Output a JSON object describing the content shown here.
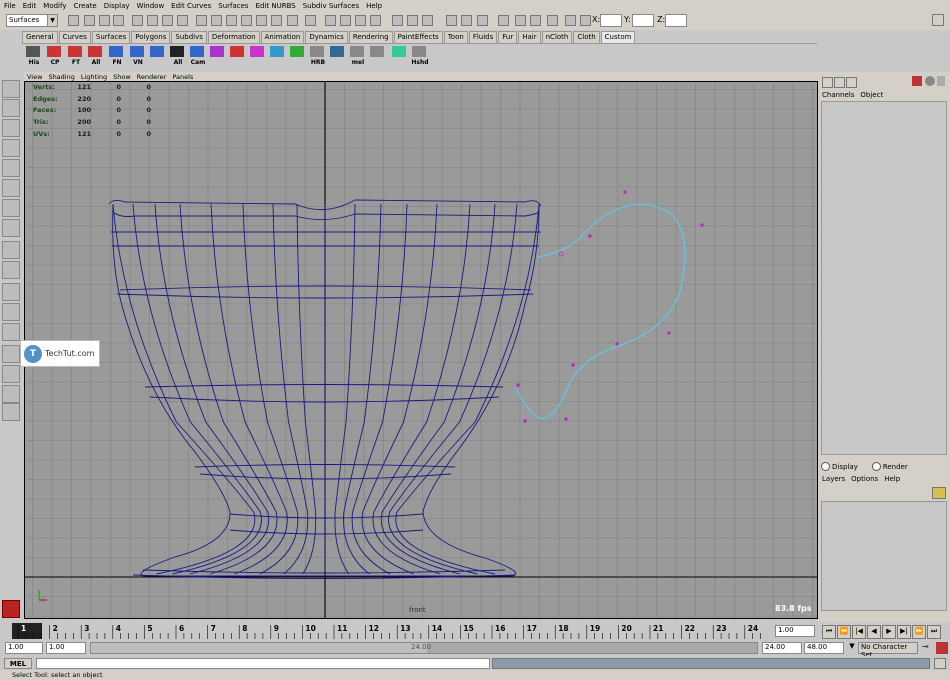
{
  "menu": [
    "File",
    "Edit",
    "Modify",
    "Create",
    "Display",
    "Window",
    "Edit Curves",
    "Surfaces",
    "Edit NURBS",
    "Subdiv Surfaces",
    "Help"
  ],
  "status_line": {
    "mode": "Surfaces",
    "x_label": "X:",
    "y_label": "Y:",
    "z_label": "Z:"
  },
  "shelf_tabs": [
    "General",
    "Curves",
    "Surfaces",
    "Polygons",
    "Subdivs",
    "Deformation",
    "Animation",
    "Dynamics",
    "Rendering",
    "PaintEffects",
    "Toon",
    "Fluids",
    "Fur",
    "Hair",
    "nCloth",
    "Cloth",
    "Custom"
  ],
  "active_shelf_tab": "Custom",
  "shelf_buttons": [
    "His",
    "CP",
    "FT",
    "All",
    "FN",
    "VN",
    "",
    "All",
    "Cam",
    "",
    "",
    "",
    "",
    "",
    "HRB",
    "",
    "mel",
    "",
    "",
    "Hshd"
  ],
  "panel_menu": [
    "View",
    "Shading",
    "Lighting",
    "Show",
    "Renderer",
    "Panels"
  ],
  "hud": [
    {
      "label": "Verts:",
      "v1": "121",
      "v2": "0",
      "v3": "0"
    },
    {
      "label": "Edges:",
      "v1": "220",
      "v2": "0",
      "v3": "0"
    },
    {
      "label": "Faces:",
      "v1": "100",
      "v2": "0",
      "v3": "0"
    },
    {
      "label": "Tris:",
      "v1": "200",
      "v2": "0",
      "v3": "0"
    },
    {
      "label": "UVs:",
      "v1": "121",
      "v2": "0",
      "v3": "0"
    }
  ],
  "viewport": {
    "camera_label": "front",
    "fps": "83.8 fps",
    "watermark": "TechTut.com"
  },
  "channel_box": {
    "tabs": [
      "Channels",
      "Object"
    ]
  },
  "layer_editor": {
    "display_label": "Display",
    "render_label": "Render",
    "menu": [
      "Layers",
      "Options",
      "Help"
    ]
  },
  "timeline": {
    "ticks": [
      "1",
      "2",
      "3",
      "4",
      "5",
      "6",
      "7",
      "8",
      "9",
      "10",
      "11",
      "12",
      "13",
      "14",
      "15",
      "16",
      "17",
      "18",
      "19",
      "20",
      "21",
      "22",
      "23",
      "24"
    ],
    "current_frame": "1.00"
  },
  "range": {
    "start": "1.00",
    "inner_start": "1.00",
    "slider_label": "24.00",
    "inner_end": "24.00",
    "end": "48.00",
    "character_set": "No Character Set"
  },
  "command": {
    "label": "MEL"
  },
  "help_line": "Select Tool: select an object",
  "colors": {
    "viewport_bg": "#9a9a9a",
    "wireframe": "#1a1a80",
    "curve": "#5fc8e8",
    "cv": "#c020c0"
  }
}
